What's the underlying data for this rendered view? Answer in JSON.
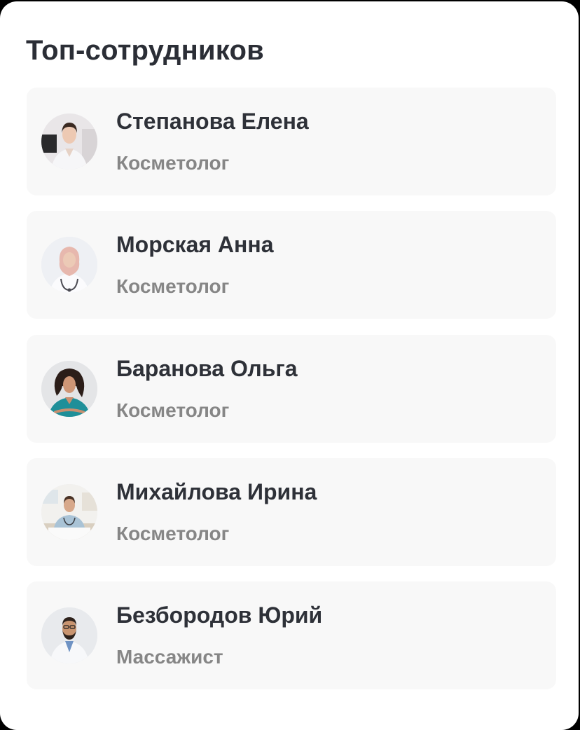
{
  "widget": {
    "title": "Топ-сотрудников"
  },
  "employees": [
    {
      "name": "Степанова Елена",
      "role": "Косметолог",
      "avatar_icon": "woman-white-coat-portrait"
    },
    {
      "name": "Морская Анна",
      "role": "Косметолог",
      "avatar_icon": "woman-hijab-stethoscope-portrait"
    },
    {
      "name": "Баранова Ольга",
      "role": "Косметолог",
      "avatar_icon": "woman-teal-scrubs-portrait"
    },
    {
      "name": "Михайлова Ирина",
      "role": "Косметолог",
      "avatar_icon": "woman-clinic-stethoscope-portrait"
    },
    {
      "name": "Безбородов Юрий",
      "role": "Массажист",
      "avatar_icon": "man-beard-white-coat-portrait"
    }
  ],
  "colors": {
    "background": "#000000",
    "card": "#ffffff",
    "item_background": "#f8f8f8",
    "title_text": "#2b2e36",
    "name_text": "#2e3138",
    "role_text": "#868686"
  }
}
